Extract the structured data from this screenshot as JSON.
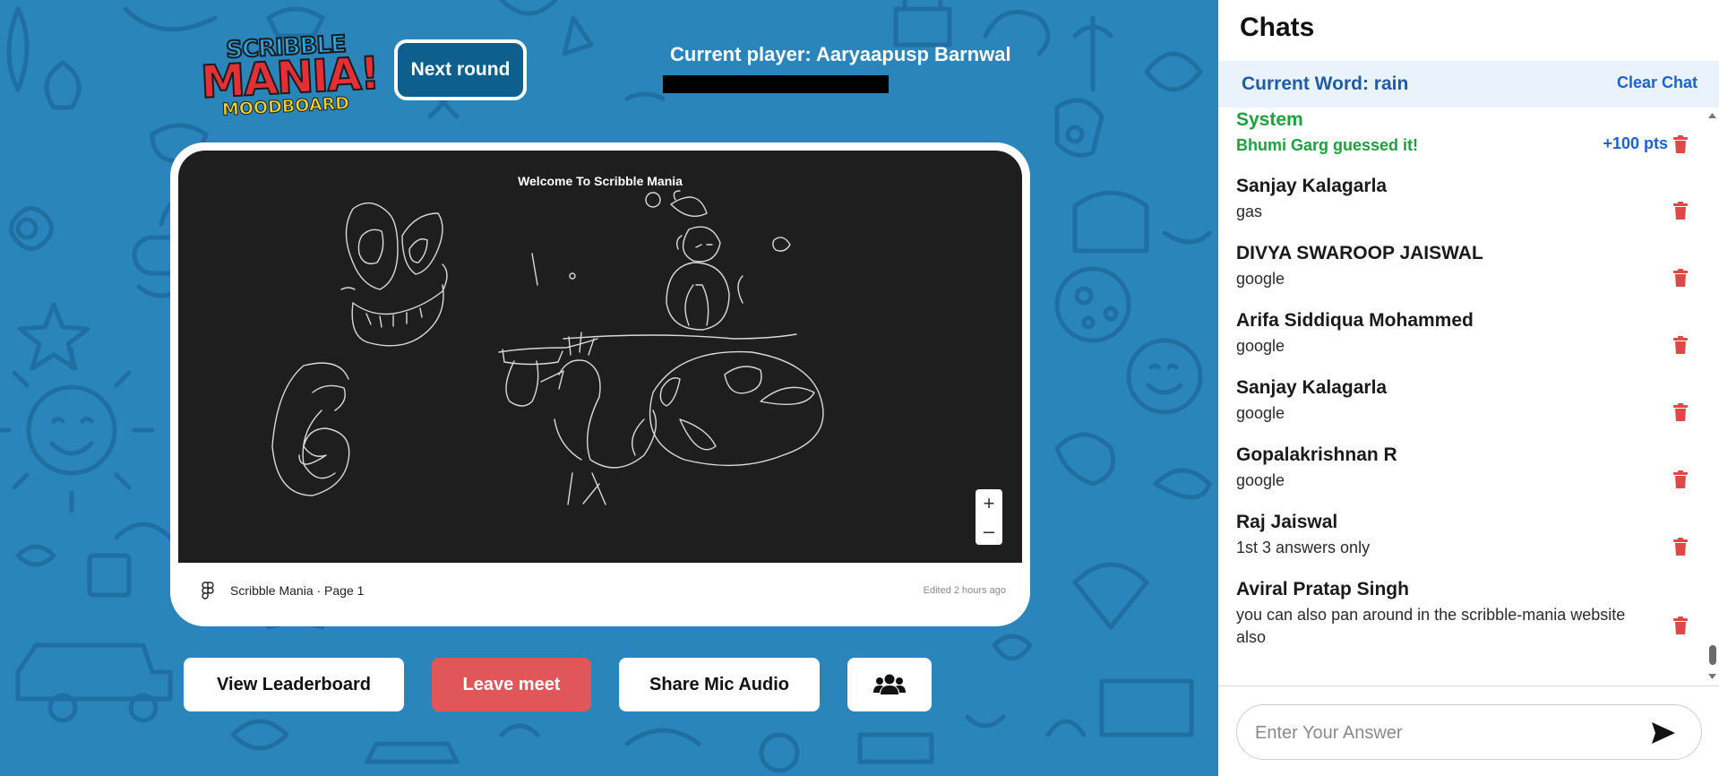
{
  "header": {
    "logo_line1": "SCRIBBLE",
    "logo_line2": "MANIA!",
    "logo_line3": "MOODBOARD",
    "next_round_label": "Next round",
    "current_player": "Current player: Aaryaapusp Barnwal"
  },
  "board": {
    "canvas_title": "Welcome To Scribble Mania",
    "zoom_in": "+",
    "zoom_out": "–",
    "footer_title": "Scribble Mania · Page 1",
    "footer_edited": "Edited 2 hours ago"
  },
  "actions": {
    "leaderboard_label": "View Leaderboard",
    "leave_label": "Leave meet",
    "mic_label": "Share Mic Audio",
    "people_icon": "users-icon"
  },
  "chat": {
    "heading": "Chats",
    "current_word": "Current Word: rain",
    "clear_label": "Clear Chat",
    "messages": [
      {
        "name": "System",
        "text": "Bhumi Garg guessed it!",
        "points": "+100 pts"
      },
      {
        "name": "Sanjay Kalagarla",
        "text": "gas"
      },
      {
        "name": "DIVYA SWAROOP JAISWAL",
        "text": "google"
      },
      {
        "name": "Arifa Siddiqua Mohammed",
        "text": "google"
      },
      {
        "name": "Sanjay Kalagarla",
        "text": "google"
      },
      {
        "name": "Gopalakrishnan R",
        "text": "google"
      },
      {
        "name": "Raj Jaiswal",
        "text": "1st 3 answers only"
      },
      {
        "name": "Aviral Pratap Singh",
        "text": "you can also pan around in the scribble-mania website also"
      }
    ],
    "input_placeholder": "Enter Your Answer",
    "input_value": ""
  },
  "colors": {
    "background_blue": "#2a85ba",
    "canvas_dark": "#1e1e1e",
    "leave_red": "#e15759",
    "system_green": "#1aa33a",
    "link_blue": "#1b62d4",
    "word_bar": "#eaf2fc"
  }
}
